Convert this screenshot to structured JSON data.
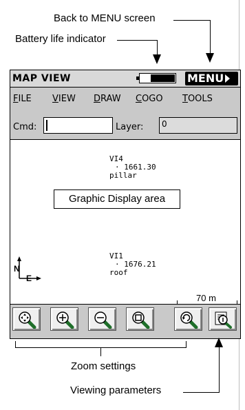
{
  "callouts": {
    "back_to_menu": "Back to MENU screen",
    "battery_life": "Battery life indicator",
    "zoom_settings": "Zoom settings",
    "viewing_parameters": "Viewing parameters"
  },
  "window": {
    "title": "MAP VIEW",
    "menu_button": "MENU",
    "battery_level": 0.72
  },
  "menubar": [
    "FILE",
    "VIEW",
    "DRAW",
    "COGO",
    "TOOLS"
  ],
  "command": {
    "cmd_label": "Cmd:",
    "cmd_value": "",
    "layer_label": "Layer:",
    "layer_value": "0"
  },
  "graphic": {
    "label": "Graphic Display area",
    "points": [
      {
        "name": "VI4",
        "elevation": "1661.30",
        "desc": "pillar"
      },
      {
        "name": "VI1",
        "elevation": "1676.21",
        "desc": "roof"
      }
    ],
    "scale": "70 m",
    "compass_n": "N",
    "compass_e": "E"
  },
  "toolbar": {
    "buttons": [
      "zoom-extents-icon",
      "zoom-in-icon",
      "zoom-out-icon",
      "zoom-window-icon",
      "zoom-previous-icon",
      "view-parameters-icon"
    ]
  },
  "colors": {
    "screen_bg": "#c9c9c9",
    "display_bg": "#ffffff",
    "menu_button_bg": "#000000"
  }
}
